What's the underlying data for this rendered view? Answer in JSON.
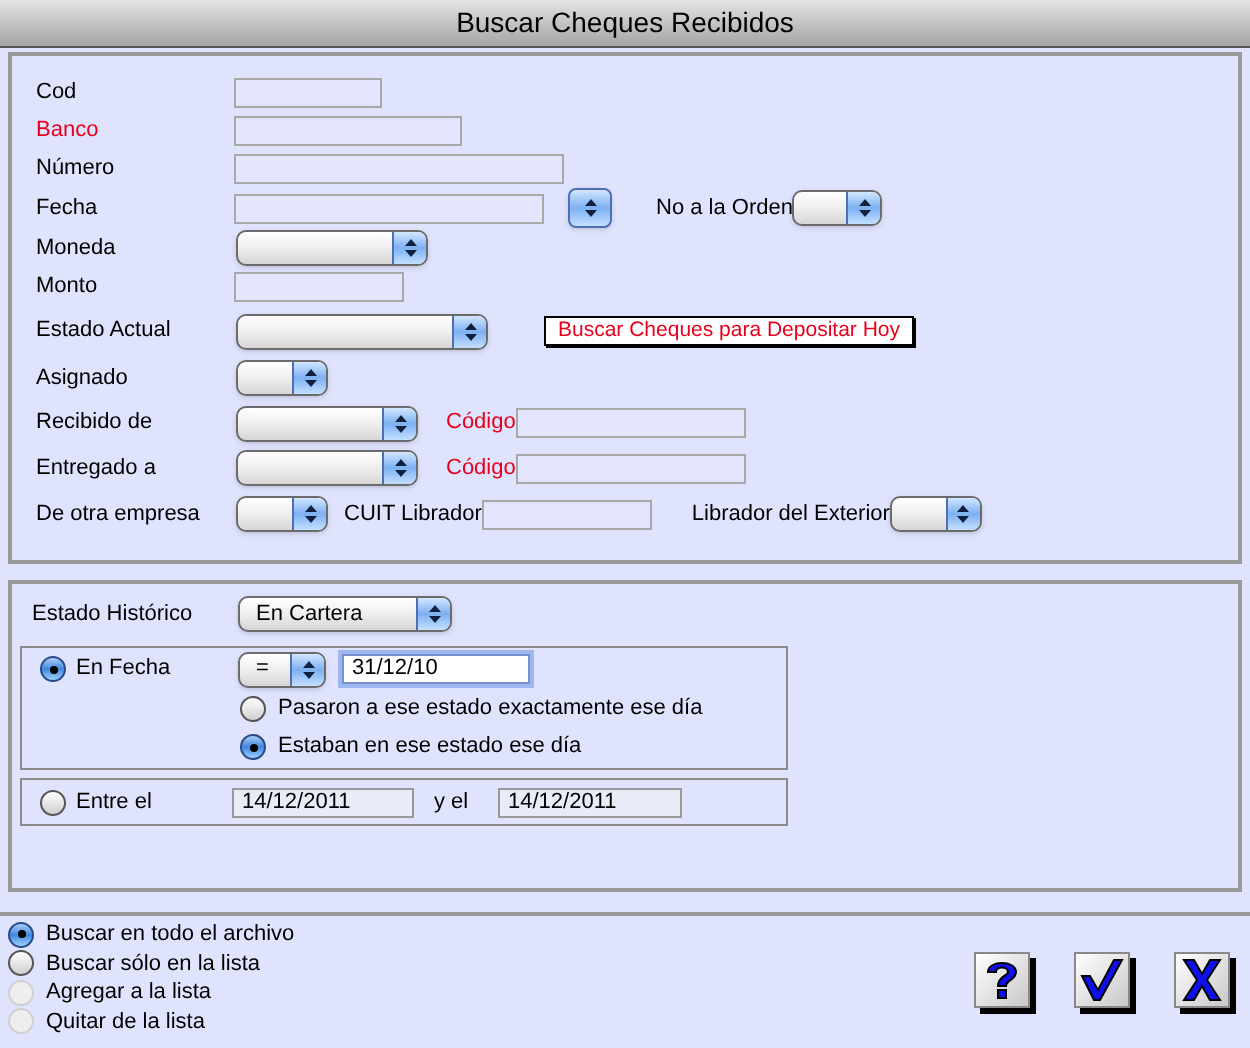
{
  "window": {
    "title": "Buscar Cheques Recibidos"
  },
  "fields": {
    "cod": {
      "label": "Cod",
      "required": false
    },
    "banco": {
      "label": "Banco",
      "required": true
    },
    "numero": {
      "label": "Número",
      "required": false
    },
    "fecha": {
      "label": "Fecha",
      "required": false
    },
    "no_a_la_orden": {
      "label": "No a la Orden",
      "required": false
    },
    "moneda": {
      "label": "Moneda",
      "required": false
    },
    "monto": {
      "label": "Monto",
      "required": false
    },
    "estado_actual": {
      "label": "Estado Actual",
      "required": false
    },
    "depositar_button": {
      "label": "Buscar Cheques para Depositar Hoy"
    },
    "asignado": {
      "label": "Asignado",
      "required": false
    },
    "recibido_de": {
      "label": "Recibido de",
      "required": false,
      "codigo_label": "Código",
      "codigo_required": true
    },
    "entregado_a": {
      "label": "Entregado a",
      "required": false,
      "codigo_label": "Código",
      "codigo_required": true
    },
    "de_otra_empresa": {
      "label": "De otra empresa",
      "required": false
    },
    "cuit_librador": {
      "label": "CUIT Librador",
      "required": false
    },
    "librador_exterior": {
      "label": "Librador del Exterior",
      "required": false
    }
  },
  "historico": {
    "label": "Estado Histórico",
    "value": "En Cartera",
    "en_fecha": {
      "label": "En Fecha",
      "selected": true,
      "operator": "=",
      "date": "31/12/10",
      "options": [
        {
          "label": "Pasaron a ese estado exactamente ese día",
          "selected": false
        },
        {
          "label": "Estaban en ese estado ese día",
          "selected": true
        }
      ]
    },
    "entre": {
      "label": "Entre el",
      "selected": false,
      "from": "14/12/2011",
      "to_label": "y el",
      "to": "14/12/2011"
    }
  },
  "scope": [
    {
      "label": "Buscar en todo el archivo",
      "selected": true,
      "disabled": false
    },
    {
      "label": "Buscar sólo en la lista",
      "selected": false,
      "disabled": false
    },
    {
      "label": "Agregar a la lista",
      "selected": false,
      "disabled": true
    },
    {
      "label": "Quitar de la lista",
      "selected": false,
      "disabled": true
    }
  ],
  "buttons": [
    {
      "kind": "help"
    },
    {
      "kind": "accept"
    },
    {
      "kind": "cancel"
    }
  ]
}
